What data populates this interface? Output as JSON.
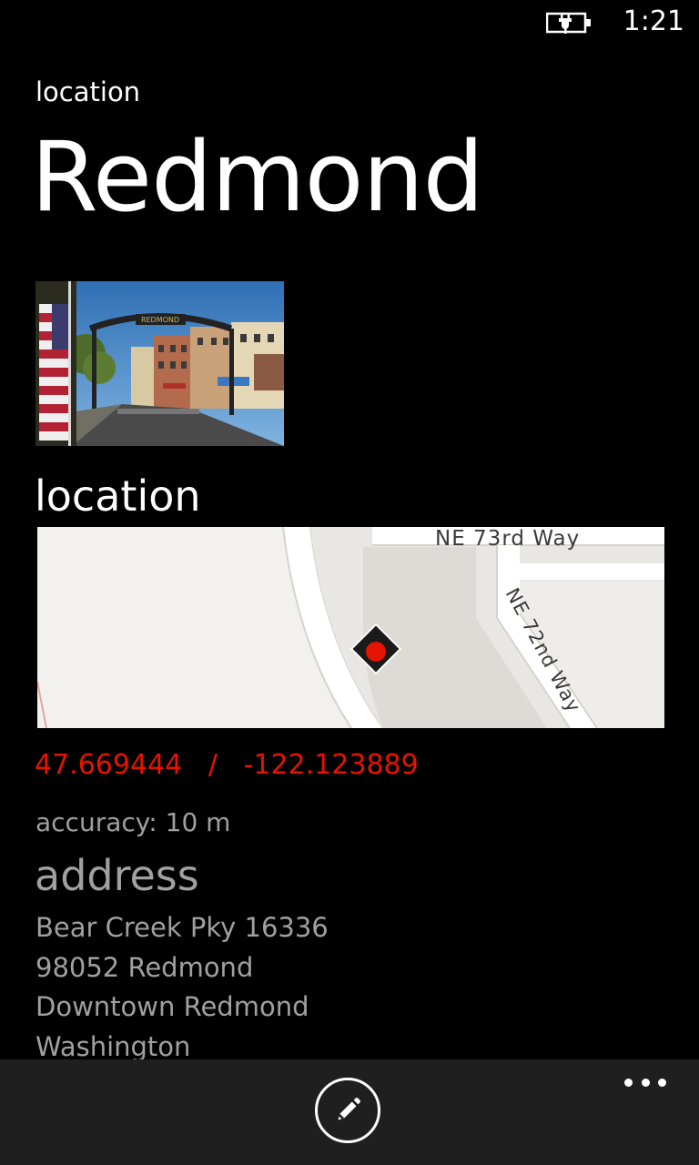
{
  "status_bar": {
    "time": "1:21",
    "battery_icon": "battery-charging-icon"
  },
  "header": {
    "app_title": "location",
    "page_title": "Redmond"
  },
  "photo": {
    "icon": "city-photo",
    "sign_text": "REDMOND"
  },
  "location_section": {
    "heading": "location",
    "map": {
      "street_1": "NE 73rd Way",
      "street_2": "NE 72nd Way",
      "pin_color": "#e51400"
    },
    "latitude": "47.669444",
    "separator": "/",
    "longitude": "-122.123889",
    "accuracy": "accuracy: 10 m"
  },
  "address_section": {
    "heading": "address",
    "lines": [
      "Bear Creek Pky 16336",
      "98052 Redmond",
      "Downtown Redmond",
      "Washington"
    ]
  },
  "app_bar": {
    "edit_icon": "pencil-edit-icon",
    "more_icon": "ellipsis-more-icon"
  },
  "colors": {
    "accent": "#e51400",
    "secondary_text": "#a0a0a0",
    "app_bar_bg": "#1f1f1f"
  }
}
